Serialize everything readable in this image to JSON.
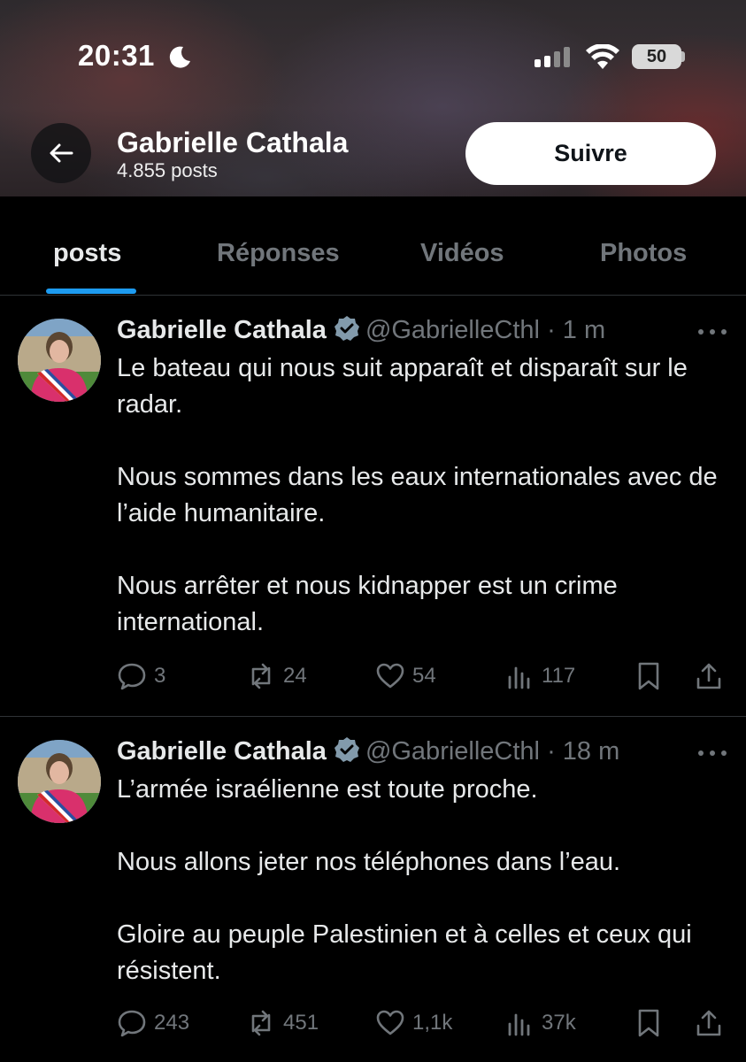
{
  "status_bar": {
    "time": "20:31",
    "battery": "50"
  },
  "header": {
    "name": "Gabrielle Cathala",
    "post_count": "4.855 posts",
    "follow_label": "Suivre"
  },
  "tabs": [
    {
      "label": "posts",
      "active": true
    },
    {
      "label": "Réponses",
      "active": false
    },
    {
      "label": "Vidéos",
      "active": false
    },
    {
      "label": "Photos",
      "active": false
    }
  ],
  "tweets": [
    {
      "name": "Gabrielle Cathala",
      "handle": "@GabrielleCthl",
      "time": "· 1 m",
      "text": "Le bateau qui nous suit apparaît et disparaît sur le radar.\n\nNous sommes dans les eaux internationales avec de l’aide humanitaire.\n\nNous arrêter et nous kidnapper est un crime international.",
      "replies": "3",
      "reposts": "24",
      "likes": "54",
      "views": "117"
    },
    {
      "name": "Gabrielle Cathala",
      "handle": "@GabrielleCthl",
      "time": "· 18 m",
      "text": "L’armée israélienne est toute proche.\n\nNous allons jeter nos téléphones dans l’eau.\n\nGloire au peuple Palestinien et à  celles et ceux qui résistent.",
      "replies": "243",
      "reposts": "451",
      "likes": "1,1k",
      "views": "37k"
    }
  ],
  "colors": {
    "accent": "#1d9bf0",
    "muted": "#71767b",
    "text": "#e7e9ea",
    "background": "#000000"
  }
}
